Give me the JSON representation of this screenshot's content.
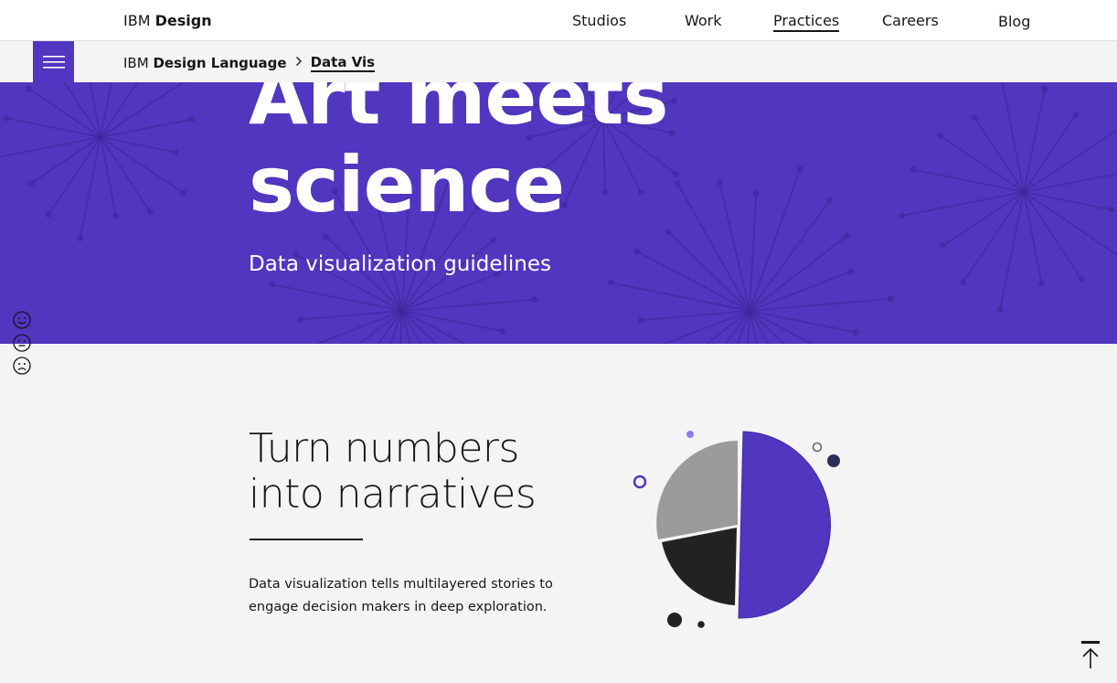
{
  "header": {
    "brand_ibm": "IBM",
    "brand_design": "Design",
    "nav": [
      {
        "label": "Studios"
      },
      {
        "label": "Work"
      },
      {
        "label": "Practices",
        "active": true
      },
      {
        "label": "Careers"
      },
      {
        "label": "Blog"
      }
    ]
  },
  "breadcrumb": {
    "root_prefix": "IBM",
    "root": "Design Language",
    "current": "Data Vis"
  },
  "hero": {
    "title": "Art meets\nscience",
    "subtitle": "Data visualization guidelines",
    "bg_color": "#5136c0"
  },
  "feedback": {
    "icons": [
      "smile-icon",
      "neutral-face-icon",
      "frown-face-icon"
    ]
  },
  "intro": {
    "title": "Turn numbers\ninto narratives",
    "body": "Data visualization tells multilayered stories to engage decision makers in deep exploration."
  },
  "illustration": {
    "slices": [
      {
        "name": "purple",
        "value": 50,
        "color": "#5136c0"
      },
      {
        "name": "dark",
        "value": 22,
        "color": "#222222"
      },
      {
        "name": "gray",
        "value": 28,
        "color": "#9b9b9b"
      }
    ]
  },
  "colors": {
    "accent": "#5136c0",
    "text": "#171717",
    "page_bg": "#f4f4f4"
  },
  "back_to_top_icon": "arrow-up-to-top-icon"
}
